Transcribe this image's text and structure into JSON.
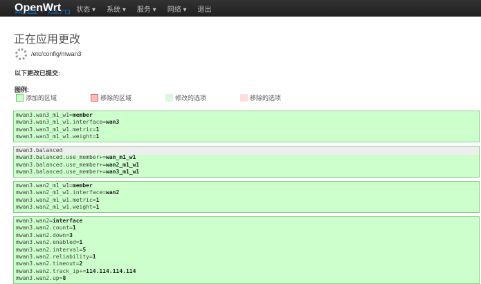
{
  "nav": {
    "brand": "OpenWrt",
    "items": [
      "状态 ▾",
      "系统 ▾",
      "服务 ▾",
      "网络 ▾",
      "退出"
    ]
  },
  "breadcrumb": "配置 / 应用",
  "title": "正在应用更改",
  "config_path": "/etc/config/mwan3",
  "submitted_label": "以下更改已提交:",
  "legend": {
    "label": "图例:",
    "items": [
      {
        "label": "添加的区域",
        "bg": "#ccffcc",
        "border": "#66cc66"
      },
      {
        "label": "移除的区域",
        "bg": "#ffbbbb",
        "border": "#cc6666"
      },
      {
        "label": "修改的选项",
        "bg": "#dff5df",
        "border": "#dff5df"
      },
      {
        "label": "移除的选项",
        "bg": "#ffdddd",
        "border": "#ffdddd"
      }
    ]
  },
  "blocks": [
    {
      "header": false,
      "lines": [
        {
          "k": "mwan3.wan3_m1_w1=",
          "v": "member"
        },
        {
          "k": "mwan3.wan3_m1_w1.interface=",
          "v": "wan3"
        },
        {
          "k": "mwan3.wan3_m1_w1.metric=",
          "v": "1"
        },
        {
          "k": "mwan3.wan3_m1_w1.weight=",
          "v": "1"
        }
      ]
    },
    {
      "header": true,
      "lines": [
        {
          "k": "mwan3.balanced",
          "v": ""
        },
        {
          "k": "mwan3.balanced.use_member+=",
          "v": "wan_m1_w1"
        },
        {
          "k": "mwan3.balanced.use_member+=",
          "v": "wan2_m1_w1"
        },
        {
          "k": "mwan3.balanced.use_member+=",
          "v": "wan3_m1_w1"
        }
      ]
    },
    {
      "header": false,
      "lines": [
        {
          "k": "mwan3.wan2_m1_w1=",
          "v": "member"
        },
        {
          "k": "mwan3.wan2_m1_w1.interface=",
          "v": "wan2"
        },
        {
          "k": "mwan3.wan2_m1_w1.metric=",
          "v": "1"
        },
        {
          "k": "mwan3.wan2_m1_w1.weight=",
          "v": "1"
        }
      ]
    },
    {
      "header": false,
      "lines": [
        {
          "k": "mwan3.wan2=",
          "v": "interface"
        },
        {
          "k": "mwan3.wan2.count=",
          "v": "1"
        },
        {
          "k": "mwan3.wan2.down=",
          "v": "3"
        },
        {
          "k": "mwan3.wan2.enabled=",
          "v": "1"
        },
        {
          "k": "mwan3.wan2.interval=",
          "v": "5"
        },
        {
          "k": "mwan3.wan2.reliability=",
          "v": "1"
        },
        {
          "k": "mwan3.wan2.timeout=",
          "v": "2"
        },
        {
          "k": "mwan3.wan2.track_ip+=",
          "v": "114.114.114.114"
        },
        {
          "k": "mwan3.wan2.up=",
          "v": "8"
        }
      ]
    }
  ]
}
